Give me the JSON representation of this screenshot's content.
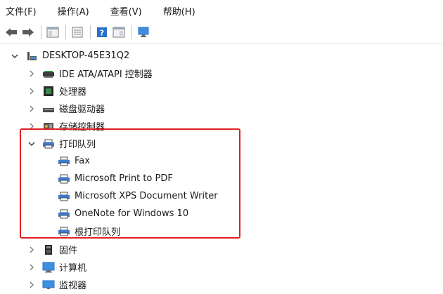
{
  "menubar": {
    "items": [
      "文件(F)",
      "操作(A)",
      "查看(V)",
      "帮助(H)"
    ]
  },
  "toolbar": {
    "buttons": [
      "back-arrow-icon",
      "forward-arrow-icon",
      "properties-pane-icon",
      "window-icon",
      "help-icon",
      "action-pane-icon",
      "monitor-icon"
    ]
  },
  "tree": {
    "root": "DESKTOP-45E31Q2",
    "categories": [
      {
        "label": "IDE ATA/ATAPI 控制器",
        "icon": "ide-controller-icon"
      },
      {
        "label": "处理器",
        "icon": "processor-icon"
      },
      {
        "label": "磁盘驱动器",
        "icon": "disk-drive-icon"
      },
      {
        "label": "存储控制器",
        "icon": "storage-controller-icon"
      },
      {
        "label": "打印队列",
        "icon": "printer-icon",
        "expanded": true,
        "children": [
          "Fax",
          "Microsoft Print to PDF",
          "Microsoft XPS Document Writer",
          "OneNote for Windows 10",
          "根打印队列"
        ]
      },
      {
        "label": "固件",
        "icon": "firmware-icon"
      },
      {
        "label": "计算机",
        "icon": "computer-icon"
      },
      {
        "label": "监视器",
        "icon": "monitor-icon"
      }
    ]
  },
  "colors": {
    "highlight_border": "#e02020",
    "icon_blue": "#2a6fc9"
  }
}
